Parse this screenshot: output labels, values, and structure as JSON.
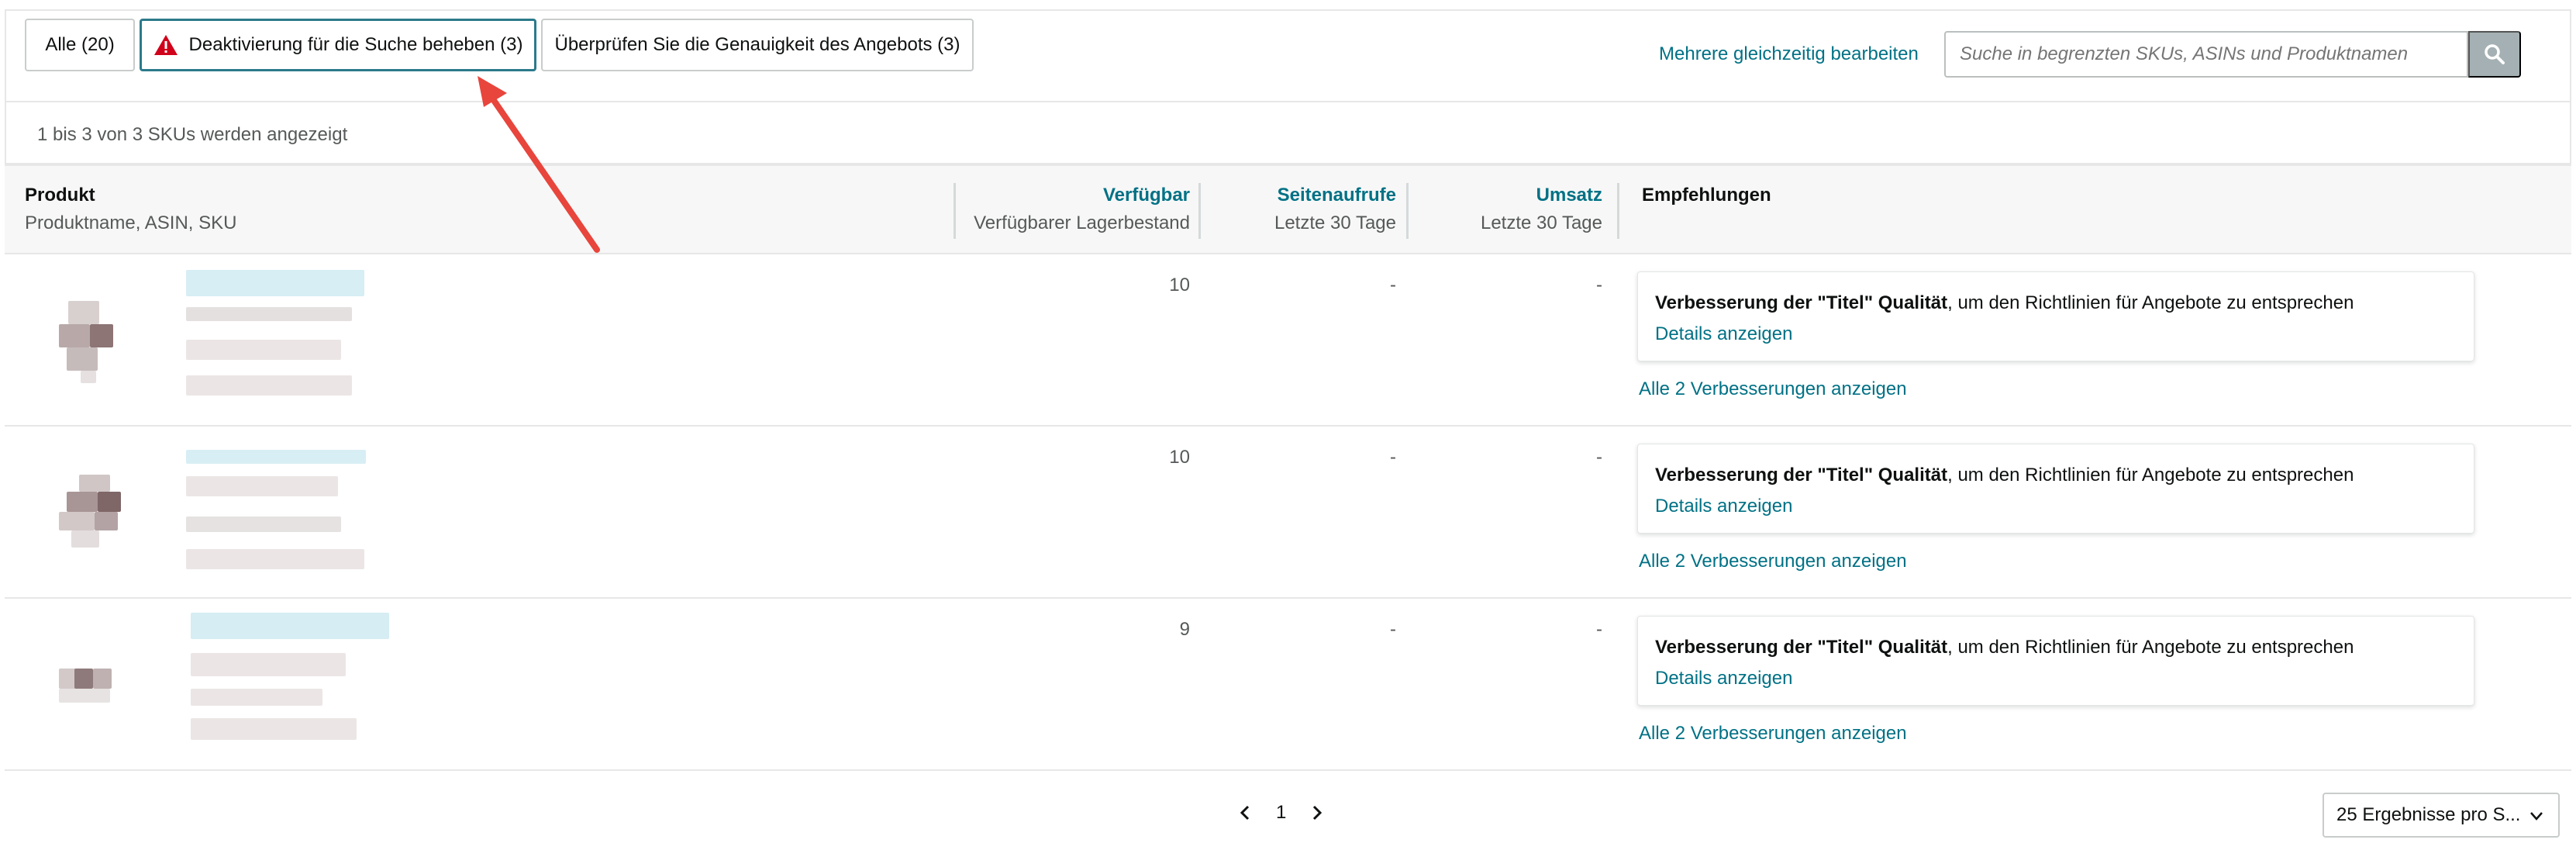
{
  "filters": {
    "tabs": [
      {
        "label": "Alle (20)"
      },
      {
        "label": "Deaktivierung für die Suche beheben (3)"
      },
      {
        "label": "Überprüfen Sie die Genauigkeit des Angebots (3)"
      }
    ],
    "bulk_edit_label": "Mehrere gleichzeitig bearbeiten",
    "search_placeholder": "Suche in begrenzten SKUs, ASINs und Produktnamen"
  },
  "count_text": "1 bis 3 von 3 SKUs werden angezeigt",
  "table": {
    "headers": {
      "product": {
        "title": "Produkt",
        "subtitle": "Produktname, ASIN, SKU"
      },
      "available": {
        "title": "Verfügbar",
        "subtitle": "Verfügbarer Lagerbestand"
      },
      "pageviews": {
        "title": "Seitenaufrufe",
        "subtitle": "Letzte 30 Tage"
      },
      "sales": {
        "title": "Umsatz",
        "subtitle": "Letzte 30 Tage"
      },
      "recommendations": {
        "title": "Empfehlungen"
      }
    },
    "rows": [
      {
        "available": "10",
        "pageviews": "-",
        "sales": "-",
        "rec_bold": "Verbesserung der \"Titel\" Qualität",
        "rec_rest": ", um den Richtlinien für Angebote zu entsprechen",
        "details": "Details anzeigen",
        "all": "Alle 2 Verbesserungen anzeigen"
      },
      {
        "available": "10",
        "pageviews": "-",
        "sales": "-",
        "rec_bold": "Verbesserung der \"Titel\" Qualität",
        "rec_rest": ", um den Richtlinien für Angebote zu entsprechen",
        "details": "Details anzeigen",
        "all": "Alle 2 Verbesserungen anzeigen"
      },
      {
        "available": "9",
        "pageviews": "-",
        "sales": "-",
        "rec_bold": "Verbesserung der \"Titel\" Qualität",
        "rec_rest": ", um den Richtlinien für Angebote zu entsprechen",
        "details": "Details anzeigen",
        "all": "Alle 2 Verbesserungen anzeigen"
      }
    ]
  },
  "pagination": {
    "current_page": "1",
    "per_page": "25 Ergebnisse pro S..."
  },
  "colors": {
    "link": "#007185",
    "accent_border": "#2b7a8b",
    "warning": "#d0021b",
    "annotation_arrow": "#e8453c"
  },
  "icons": {
    "warning": "warning-triangle-icon",
    "search": "search-icon",
    "prev": "chevron-left-icon",
    "next": "chevron-right-icon",
    "dropdown": "chevron-down-icon"
  }
}
